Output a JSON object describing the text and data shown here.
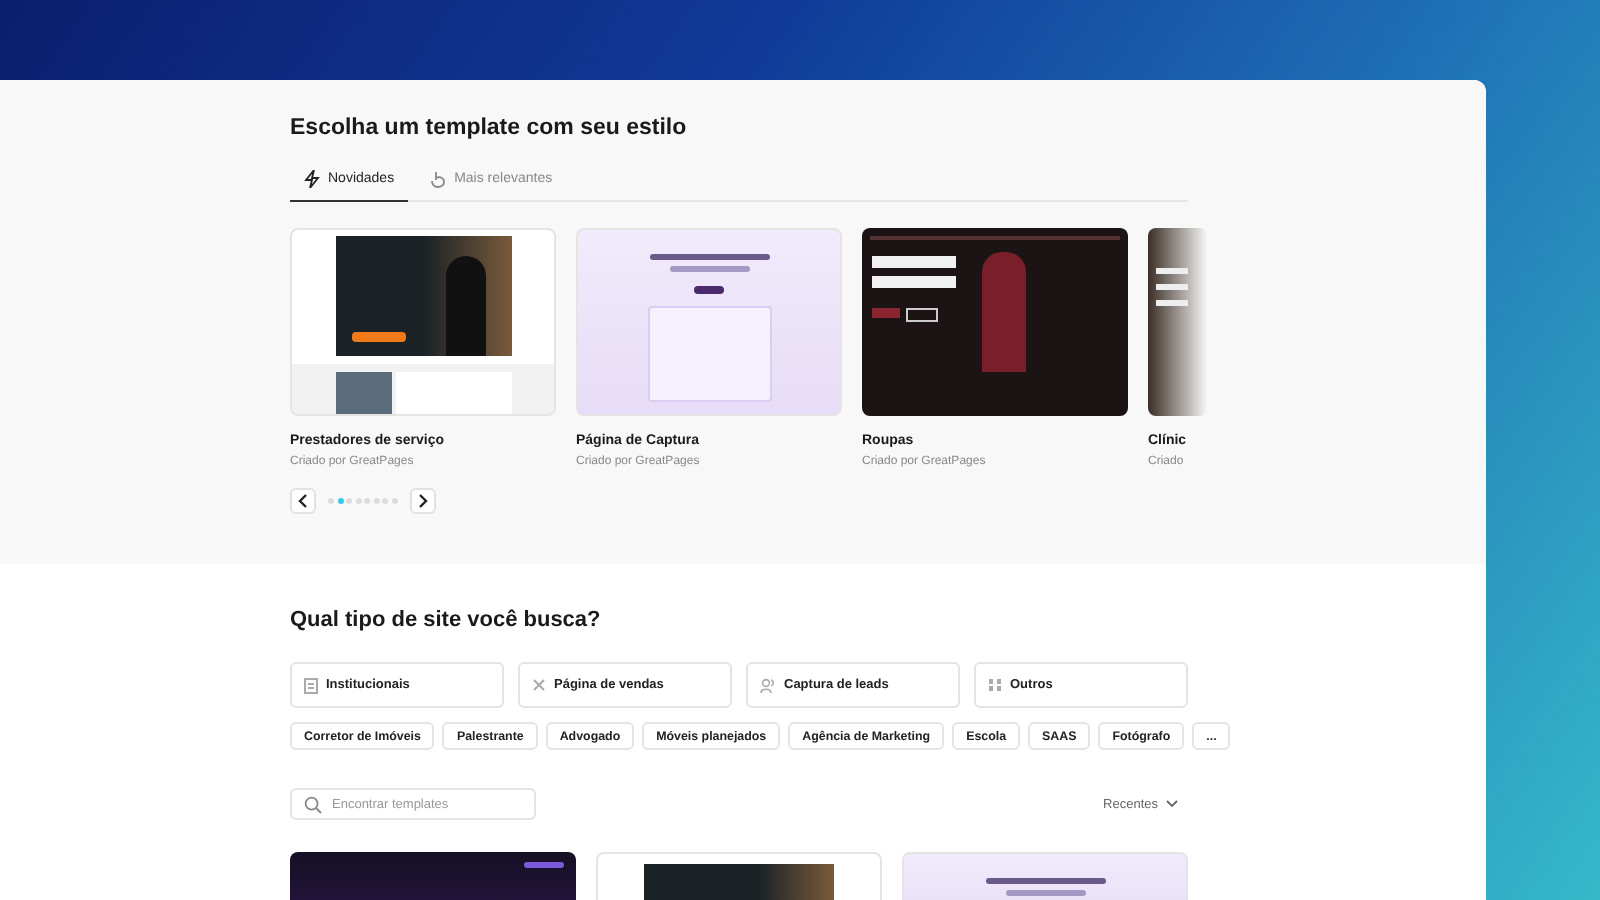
{
  "featured": {
    "title": "Escolha um template com seu estilo",
    "tabs": [
      {
        "label": "Novidades",
        "selected": true
      },
      {
        "label": "Mais relevantes",
        "selected": false
      }
    ],
    "templates": [
      {
        "name": "Prestadores de serviço",
        "author": "Criado por GreatPages",
        "kind": "service"
      },
      {
        "name": "Página de Captura",
        "author": "Criado por GreatPages",
        "kind": "capture"
      },
      {
        "name": "Roupas",
        "author": "Criado por GreatPages",
        "kind": "clothing"
      },
      {
        "name": "Clínic",
        "author": "Criado",
        "kind": "clinic"
      }
    ],
    "pager": [
      {
        "selected": false
      },
      {
        "selected": true
      },
      {
        "selected": false
      },
      {
        "selected": false
      },
      {
        "selected": false
      },
      {
        "selected": false
      },
      {
        "selected": false
      },
      {
        "selected": false
      }
    ]
  },
  "browse": {
    "title": "Qual tipo de site você busca?",
    "categories": [
      {
        "label": "Institucionais"
      },
      {
        "label": "Página de vendas"
      },
      {
        "label": "Captura de leads"
      },
      {
        "label": "Outros"
      }
    ],
    "chips": [
      "Corretor de Imóveis",
      "Palestrante",
      "Advogado",
      "Móveis planejados",
      "Agência de Marketing",
      "Escola",
      "SAAS",
      "Fotógrafo",
      "..."
    ],
    "search": {
      "placeholder": "Encontrar templates"
    },
    "sort": {
      "label": "Recentes"
    },
    "results": [
      {
        "kind": "dark"
      },
      {
        "kind": "service"
      },
      {
        "kind": "capture"
      }
    ]
  }
}
